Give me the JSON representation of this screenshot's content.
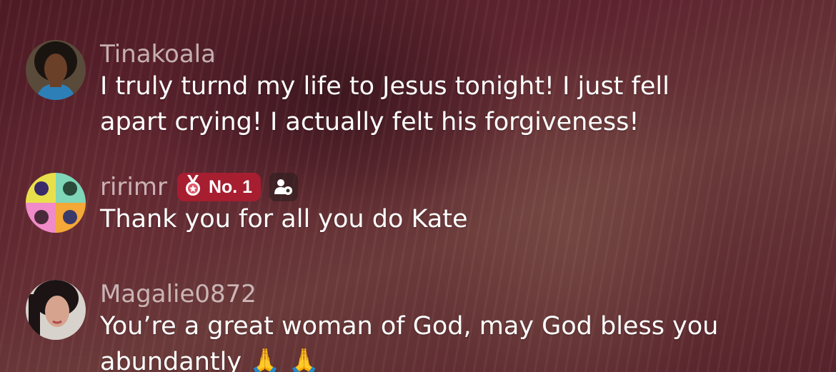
{
  "comments": [
    {
      "username": "Tinakoala",
      "message_lines": [
        "I truly turnd my life to Jesus tonight! I just fell",
        "apart crying! I actually felt his forgiveness!"
      ],
      "avatar_icon": "user-avatar-photo"
    },
    {
      "username": "ririmr",
      "badge_text": "No. 1",
      "badge_icon": "medal-icon",
      "badge_color": "#a61e30",
      "extra_icon": "fan-club-icon",
      "message_lines": [
        "Thank you for all you do Kate"
      ],
      "avatar_icon": "pop-art-avatar"
    },
    {
      "username": "Magalie0872",
      "message_lines": [
        "You’re a great woman of God, may God bless you",
        "abundantly 🙏 🙏"
      ],
      "avatar_icon": "user-avatar-photo"
    }
  ]
}
